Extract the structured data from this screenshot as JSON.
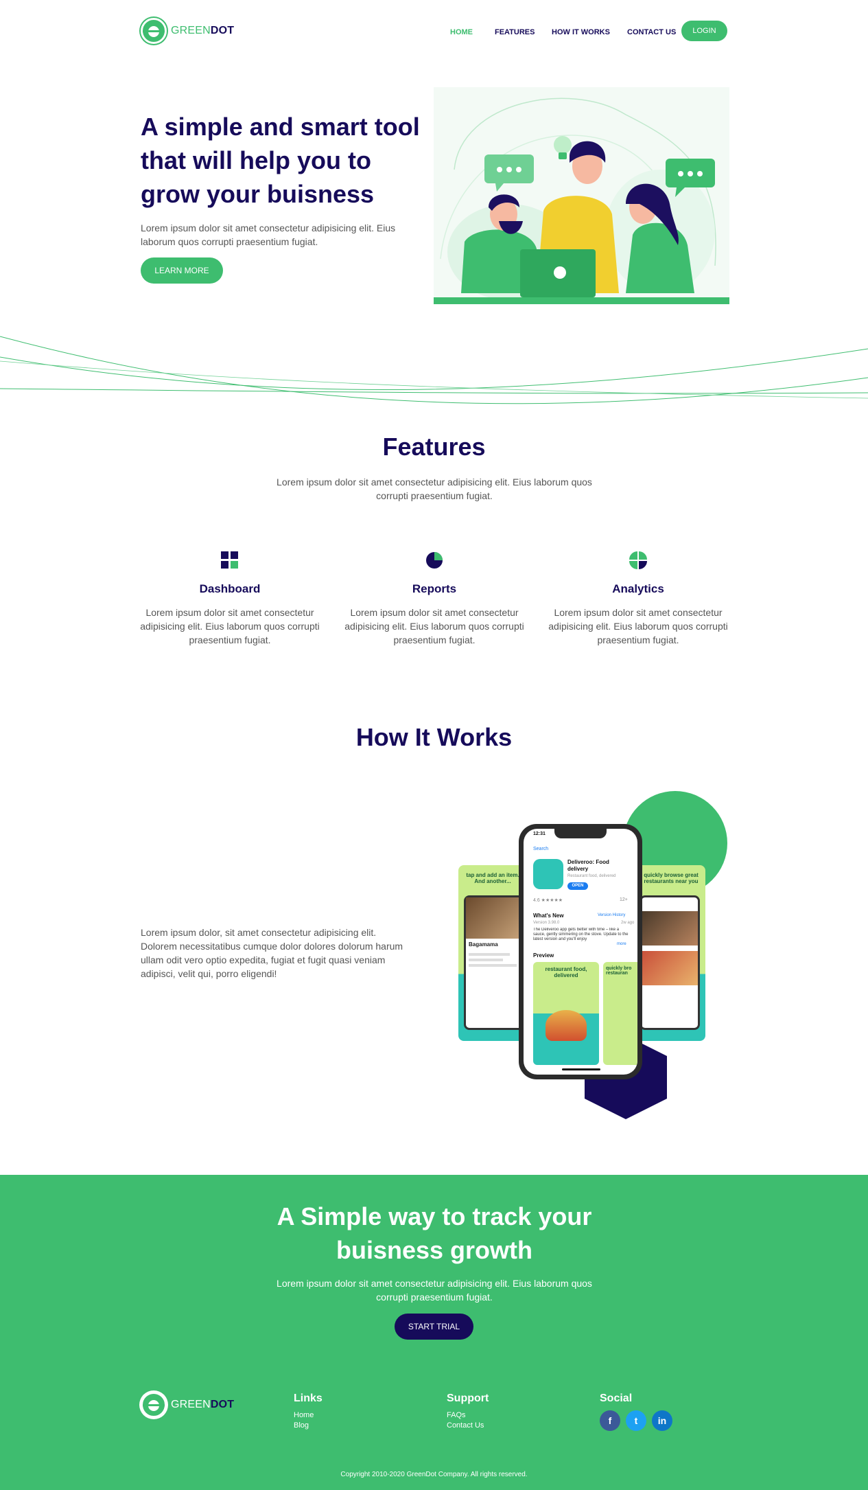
{
  "brand": {
    "part1": "GREEN",
    "part2": "DOT"
  },
  "nav": {
    "items": [
      "HOME",
      "FEATURES",
      "HOW IT WORKS",
      "CONTACT US"
    ],
    "login": "LOGIN"
  },
  "hero": {
    "title": "A simple and smart tool that will help you to grow your buisness",
    "text": "Lorem ipsum dolor sit amet consectetur adipisicing elit. Eius laborum quos corrupti praesentium fugiat.",
    "button": "LEARN MORE"
  },
  "features": {
    "title": "Features",
    "text": "Lorem ipsum dolor sit amet consectetur adipisicing elit. Eius laborum quos corrupti praesentium fugiat.",
    "items": [
      {
        "icon": "dashboard-icon",
        "title": "Dashboard",
        "text": "Lorem ipsum dolor sit amet consectetur adipisicing elit. Eius laborum quos corrupti praesentium fugiat."
      },
      {
        "icon": "pie-chart-icon",
        "title": "Reports",
        "text": "Lorem ipsum dolor sit amet consectetur adipisicing elit. Eius laborum quos corrupti praesentium fugiat."
      },
      {
        "icon": "analytics-icon",
        "title": "Analytics",
        "text": "Lorem ipsum dolor sit amet consectetur adipisicing elit. Eius laborum quos corrupti praesentium fugiat."
      }
    ]
  },
  "how": {
    "title": "How It Works",
    "text": "Lorem ipsum dolor, sit amet consectetur adipisicing elit. Dolorem necessitatibus cumque dolor dolores dolorum harum ullam odit vero optio expedita, fugiat et fugit quasi veniam adipisci, velit qui, porro eligendi!",
    "phone": {
      "time": "12:31",
      "back": "Search",
      "app_name": "Deliveroo: Food delivery",
      "app_sub": "Restaurant food, delivered",
      "open": "OPEN",
      "rating": "4.6 ★★★★★",
      "age": "12+",
      "whats_new": "What's New",
      "version_history": "Version History",
      "version": "Version 3.98.0",
      "ago": "2w ago",
      "notes": "The Deliveroo app gets better with time – like a sauce, gently simmering on the stove. Update to the latest version and you'll enjoy",
      "more": "more",
      "preview": "Preview",
      "card_center": "restaurant food, delivered",
      "card_left": "tap and add an item. And another...",
      "card_right": "quickly browse great restaurants near you",
      "card_right_small": "quickly bro restauran",
      "left_restaurant": "Bagamama"
    }
  },
  "cta": {
    "title": "A Simple way to track your buisness growth",
    "text": "Lorem ipsum dolor sit amet consectetur adipisicing elit. Eius laborum quos corrupti praesentium fugiat.",
    "button": "START TRIAL"
  },
  "footer": {
    "links_title": "Links",
    "links": [
      "Home",
      "Blog"
    ],
    "support_title": "Support",
    "support": [
      "FAQs",
      "Contact Us"
    ],
    "social_title": "Social",
    "social": [
      {
        "icon": "facebook-icon",
        "glyph": "f",
        "color": "#3b5998"
      },
      {
        "icon": "twitter-icon",
        "glyph": "t",
        "color": "#1da1f2"
      },
      {
        "icon": "linkedin-icon",
        "glyph": "in",
        "color": "#0e76c8"
      }
    ],
    "copyright": "Copyright 2010-2020 GreenDot Company. All rights reserved."
  },
  "colors": {
    "green": "#3ebd6f",
    "navy": "#160b5a",
    "text": "#555555"
  }
}
